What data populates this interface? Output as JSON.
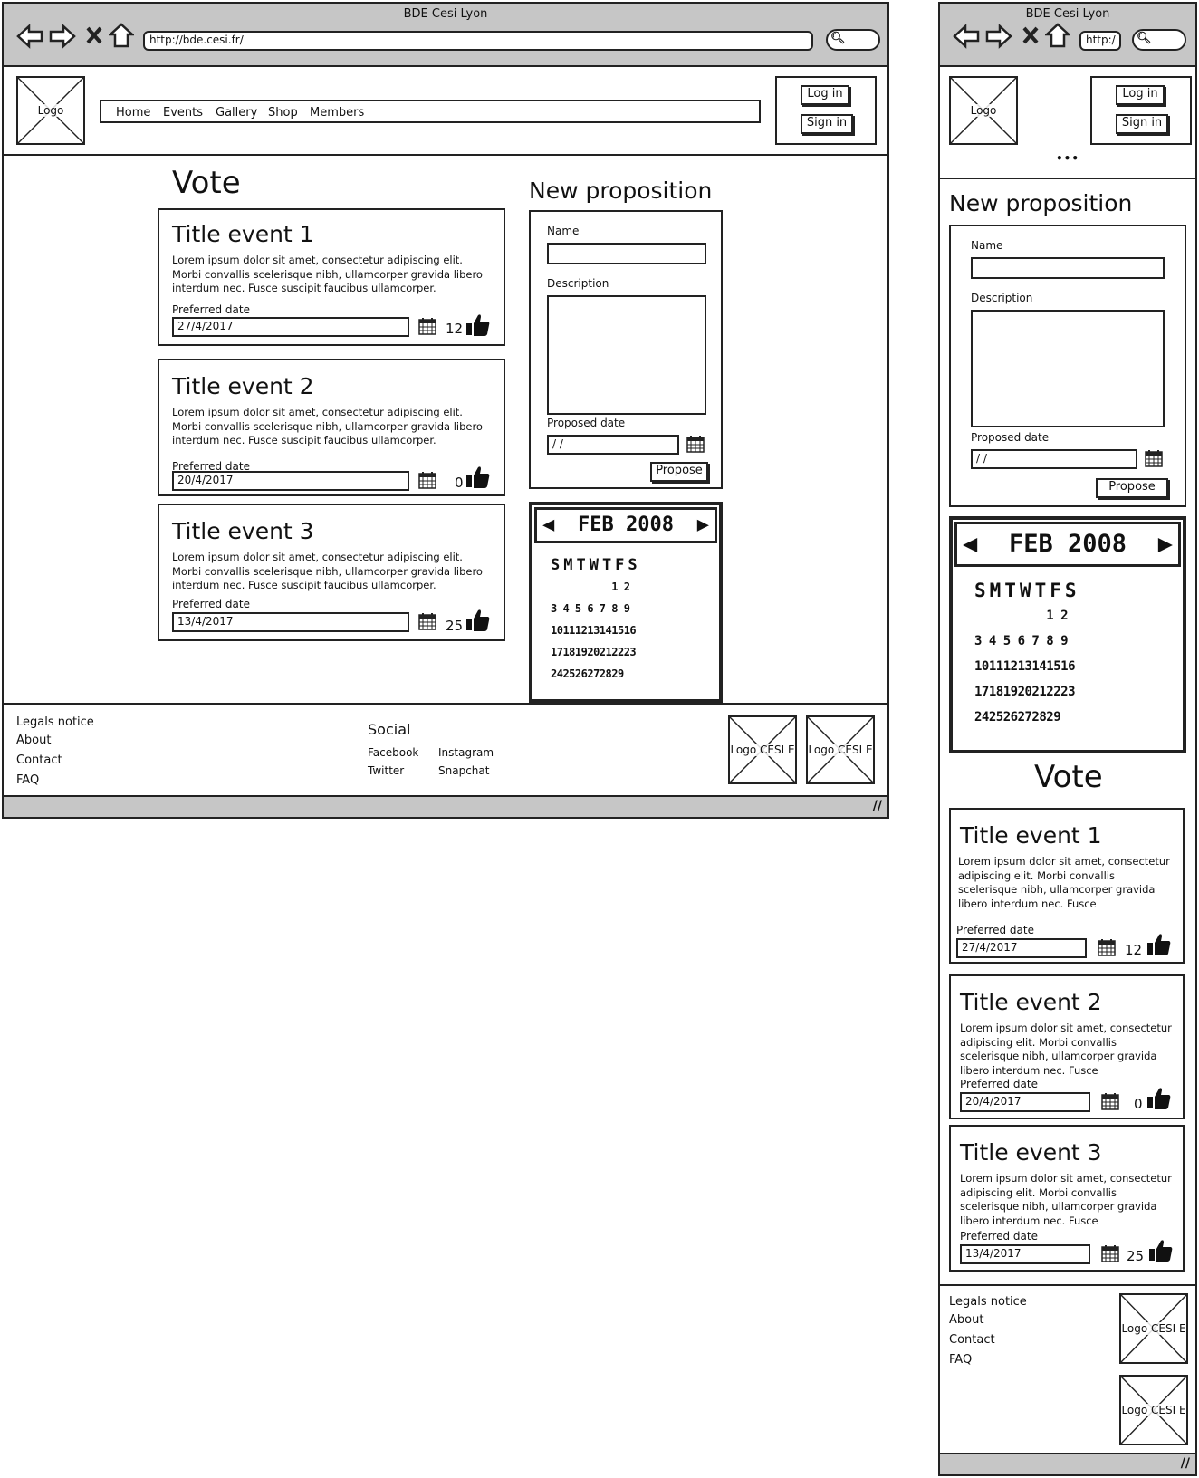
{
  "window_title": "BDE Cesi Lyon",
  "desktop": {
    "url": "http://bde.cesi.fr/",
    "logo": "Logo",
    "nav": [
      "Home",
      "Events",
      "Gallery",
      "Shop",
      "Members"
    ],
    "login": "Log in",
    "signin": "Sign in",
    "vote_title": "Vote",
    "proposition_title": "New proposition",
    "form": {
      "name_label": "Name",
      "description_label": "Description",
      "date_label": "Proposed date",
      "date_value": " /  /",
      "submit": "Propose"
    },
    "events": [
      {
        "title": "Title event 1",
        "text": "Lorem ipsum dolor sit amet, consectetur adipiscing elit. Morbi convallis scelerisque nibh, ullamcorper gravida libero interdum nec. Fusce suscipit faucibus ullamcorper.",
        "date_label": "Preferred date",
        "date": "27/4/2017",
        "likes": "12"
      },
      {
        "title": "Title event 2",
        "text": "Lorem ipsum dolor sit amet, consectetur adipiscing elit. Morbi convallis scelerisque nibh, ullamcorper gravida libero interdum nec. Fusce suscipit faucibus ullamcorper.",
        "date_label": "Preferred date",
        "date": "20/4/2017",
        "likes": "0"
      },
      {
        "title": "Title event 3",
        "text": "Lorem ipsum dolor sit amet, consectetur adipiscing elit. Morbi convallis scelerisque nibh, ullamcorper gravida libero interdum nec. Fusce suscipit faucibus ullamcorper.",
        "date_label": "Preferred date",
        "date": "13/4/2017",
        "likes": "25"
      }
    ],
    "calendar": {
      "month": "FEB 2008",
      "weekdays": "SMTWTFS",
      "rows": [
        "          1 2",
        "3 4 5 6 7 8 9",
        "10111213141516",
        "17181920212223",
        "242526272829"
      ]
    },
    "footer": {
      "links": [
        "Legals notice",
        "About",
        "Contact",
        "FAQ"
      ],
      "social_title": "Social",
      "social": [
        "Facebook",
        "Instagram",
        "Twitter",
        "Snapchat"
      ],
      "logos": [
        "Logo CESI E",
        "Logo CESI E"
      ]
    }
  },
  "mobile": {
    "url": "http:/",
    "logo": "Logo",
    "login": "Log in",
    "signin": "Sign in",
    "menu": "•••",
    "proposition_title": "New proposition",
    "form": {
      "name_label": "Name",
      "description_label": "Description",
      "date_label": "Proposed date",
      "date_value": " /  /",
      "submit": "Propose"
    },
    "vote_title": "Vote",
    "events": [
      {
        "title": "Title event 1",
        "text": "Lorem ipsum dolor sit amet, consectetur adipiscing elit. Morbi convallis scelerisque nibh, ullamcorper gravida libero interdum nec. Fusce",
        "date_label": "Preferred date",
        "date": "27/4/2017",
        "likes": "12"
      },
      {
        "title": "Title event 2",
        "text": "Lorem ipsum dolor sit amet, consectetur adipiscing elit. Morbi convallis scelerisque nibh, ullamcorper gravida libero interdum nec. Fusce",
        "date_label": "Preferred date",
        "date": "20/4/2017",
        "likes": "0"
      },
      {
        "title": "Title event 3",
        "text": "Lorem ipsum dolor sit amet, consectetur adipiscing elit. Morbi convallis scelerisque nibh, ullamcorper gravida libero interdum nec. Fusce",
        "date_label": "Preferred date",
        "date": "13/4/2017",
        "likes": "25"
      }
    ],
    "footer": {
      "links": [
        "Legals notice",
        "About",
        "Contact",
        "FAQ"
      ],
      "logos": [
        "Logo CESI E",
        "Logo CESI E"
      ]
    }
  }
}
